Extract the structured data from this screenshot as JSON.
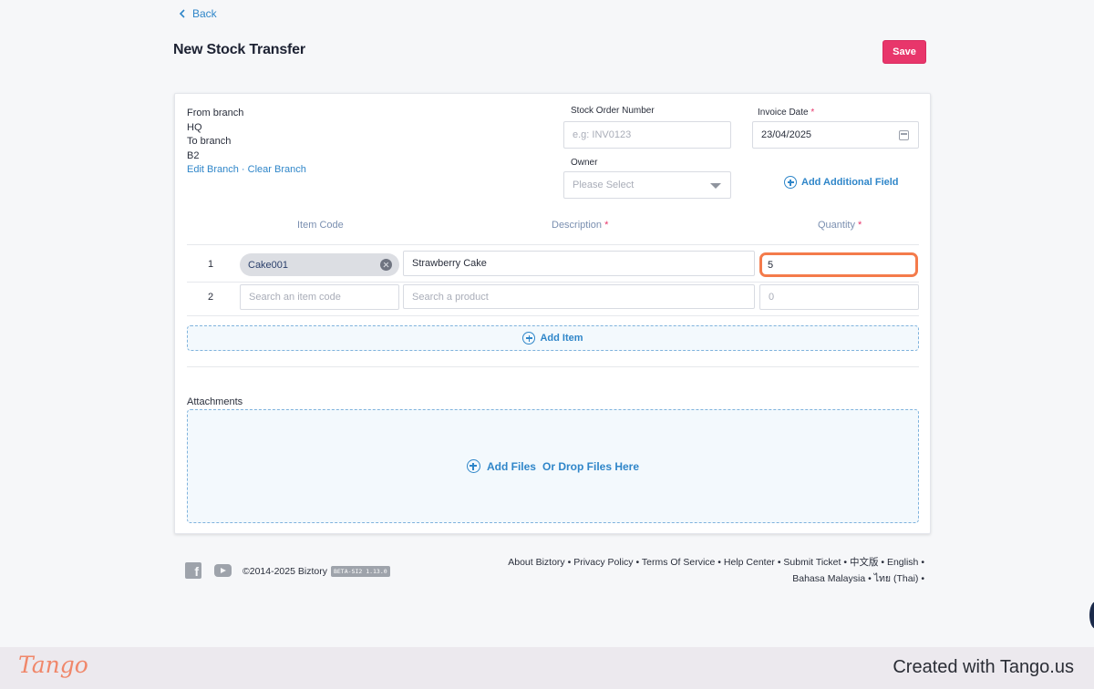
{
  "nav": {
    "back_label": "Back"
  },
  "header": {
    "title": "New Stock Transfer",
    "save_label": "Save"
  },
  "branch": {
    "from_label": "From branch",
    "from_value": "HQ",
    "to_label": "To branch",
    "to_value": "B2",
    "edit_link": "Edit Branch",
    "separator": " · ",
    "clear_link": "Clear Branch"
  },
  "form": {
    "stock_order_label": "Stock Order Number",
    "stock_order_placeholder": "e.g: INV0123",
    "invoice_date_label": "Invoice Date",
    "invoice_date_value": "23/04/2025",
    "owner_label": "Owner",
    "owner_value": "Please Select",
    "add_field_label": "Add Additional Field",
    "required_mark": "*"
  },
  "table": {
    "headers": {
      "item_code": "Item Code",
      "description": "Description",
      "quantity": "Quantity"
    },
    "rows": [
      {
        "num": "1",
        "item_code": "Cake001",
        "description": "Strawberry Cake",
        "quantity": "5"
      },
      {
        "num": "2",
        "item_code_placeholder": "Search an item code",
        "description_placeholder": "Search a product",
        "quantity_placeholder": "0"
      }
    ],
    "add_item_label": "Add Item"
  },
  "attachments": {
    "label": "Attachments",
    "add_files": "Add Files",
    "drop_text": "Or Drop Files Here"
  },
  "footer": {
    "copyright": "©2014-2025 Biztory",
    "version_badge": "BETA-SI2 1.13.0",
    "links_line1": "About Biztory • Privacy Policy • Terms Of Service • Help Center • Submit Ticket • 中文版 • English •",
    "links_line2": "Bahasa Malaysia • ไทย (Thai) •"
  },
  "tango": {
    "logo": "Tango",
    "credit": "Created with Tango.us"
  },
  "colors": {
    "accent": "#2f86c9",
    "save": "#e8366b",
    "focus_ring": "#f47b4b",
    "tango": "#f0876a"
  }
}
